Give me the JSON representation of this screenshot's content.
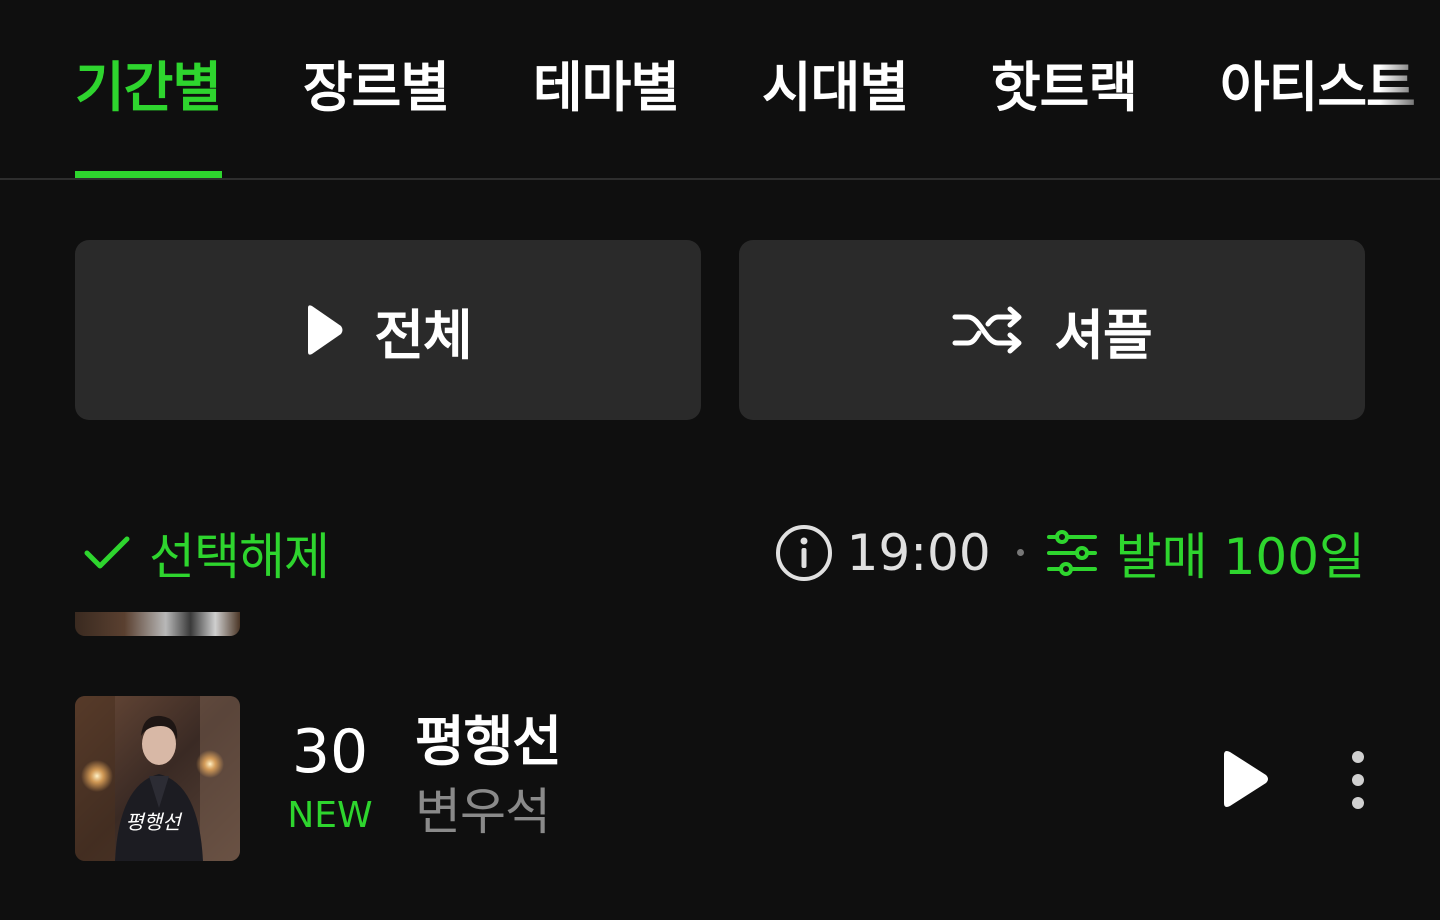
{
  "tabs": [
    {
      "label": "기간별",
      "active": true
    },
    {
      "label": "장르별",
      "active": false
    },
    {
      "label": "테마별",
      "active": false
    },
    {
      "label": "시대별",
      "active": false
    },
    {
      "label": "핫트랙",
      "active": false
    },
    {
      "label": "아티스트",
      "active": false
    }
  ],
  "actions": {
    "play_all_label": "전체",
    "shuffle_label": "셔플"
  },
  "filter": {
    "deselect_label": "선택해제",
    "time": "19:00",
    "period": "발매 100일"
  },
  "track": {
    "rank": "30",
    "badge": "NEW",
    "title": "평행선",
    "artist": "변우석",
    "album_art_text": "평행선"
  },
  "colors": {
    "accent": "#2ed52e",
    "background": "#0f0f0f",
    "button_bg": "#2a2a2a",
    "secondary_text": "#8a8a8a"
  },
  "icons": {
    "play": "play-icon",
    "shuffle": "shuffle-icon",
    "check": "check-icon",
    "info": "info-icon",
    "filter": "sliders-icon",
    "more": "more-vertical-icon"
  }
}
